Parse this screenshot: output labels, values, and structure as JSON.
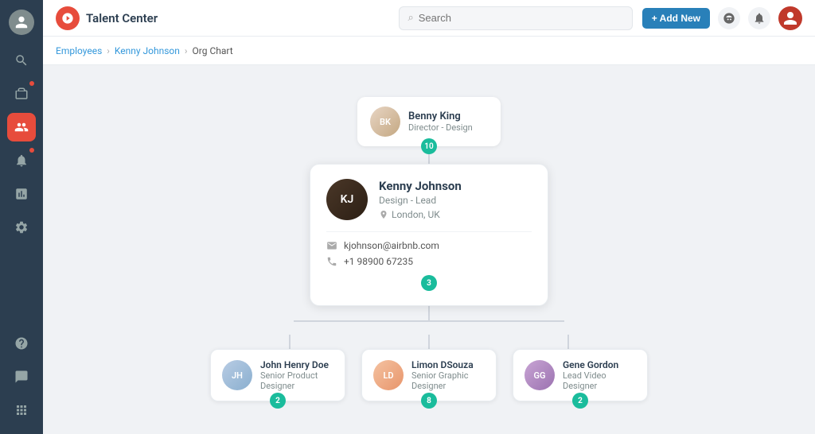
{
  "app": {
    "name": "Talent Center",
    "add_new_label": "+ Add New"
  },
  "search": {
    "placeholder": "Search"
  },
  "breadcrumb": {
    "items": [
      "Employees",
      "Kenny Johnson",
      "Org Chart"
    ]
  },
  "org": {
    "top_node": {
      "name": "Benny King",
      "role": "Director - Design",
      "badge": "10",
      "avatar_initials": "BK"
    },
    "main_node": {
      "name": "Kenny Johnson",
      "role": "Design - Lead",
      "location": "London, UK",
      "email": "kjohnson@airbnb.com",
      "phone": "+1 98900 67235",
      "badge": "3",
      "avatar_initials": "KJ"
    },
    "children": [
      {
        "name": "John Henry Doe",
        "role": "Senior Product Designer",
        "badge": "2",
        "avatar_initials": "JH",
        "badge_color": "teal"
      },
      {
        "name": "Limon DSouza",
        "role": "Senior Graphic Designer",
        "badge": "8",
        "avatar_initials": "LD",
        "badge_color": "teal"
      },
      {
        "name": "Gene Gordon",
        "role": "Lead Video Designer",
        "badge": "2",
        "avatar_initials": "GG",
        "badge_color": "teal"
      }
    ]
  },
  "sidebar": {
    "items": [
      {
        "icon": "person",
        "label": "Profile",
        "active": false
      },
      {
        "icon": "search",
        "label": "Search",
        "active": false
      },
      {
        "icon": "briefcase",
        "label": "Jobs",
        "active": false
      },
      {
        "icon": "people",
        "label": "People",
        "active": true
      },
      {
        "icon": "bell",
        "label": "Notifications",
        "active": false
      },
      {
        "icon": "chart",
        "label": "Reports",
        "active": false
      },
      {
        "icon": "gear",
        "label": "Settings",
        "active": false
      }
    ]
  }
}
